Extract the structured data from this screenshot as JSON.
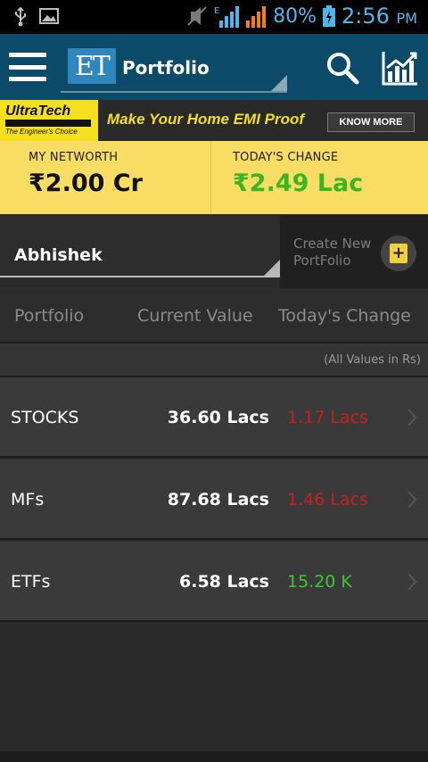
{
  "status_bar": {
    "battery_percent": "80%",
    "time": "2:56",
    "ampm": "PM",
    "network_label": "E",
    "icons": [
      "usb-icon",
      "image-icon",
      "mute-icon",
      "signal-icon",
      "battery-icon"
    ]
  },
  "app_bar": {
    "logo_text": "ET",
    "title": "Portfolio",
    "icons": [
      "menu-icon",
      "search-icon",
      "chart-icon"
    ]
  },
  "ad": {
    "brand": "UltraTech",
    "brand_sub": "CEMENT",
    "tagline": "The Engineer's Choice",
    "headline": "Make Your Home EMI Proof",
    "cta": "KNOW MORE"
  },
  "summary": {
    "networth_label": "MY NETWORTH",
    "networth_value": "₹2.00 Cr",
    "change_label": "TODAY'S CHANGE",
    "change_value": "₹2.49 Lac"
  },
  "portfolio_selector": {
    "selected": "Abhishek"
  },
  "create_portfolio": {
    "line1": "Create New",
    "line2": "PortFolio"
  },
  "table": {
    "headers": [
      "Portfolio",
      "Current Value",
      "Today's Change"
    ],
    "note": "(All Values in Rs)",
    "rows": [
      {
        "label": "STOCKS",
        "current": "36.60 Lacs",
        "change": "1.17 Lacs",
        "change_color": "#c8201d"
      },
      {
        "label": "MFs",
        "current": "87.68 Lacs",
        "change": "1.46 Lacs",
        "change_color": "#c8201d"
      },
      {
        "label": "ETFs",
        "current": "6.58 Lacs",
        "change": "15.20 K",
        "change_color": "#3fc92e"
      }
    ]
  },
  "colors": {
    "app_bar": "#0b4a68",
    "summary_bg": "#f8dc63",
    "positive": "#3cb522",
    "negative": "#c8201d"
  }
}
